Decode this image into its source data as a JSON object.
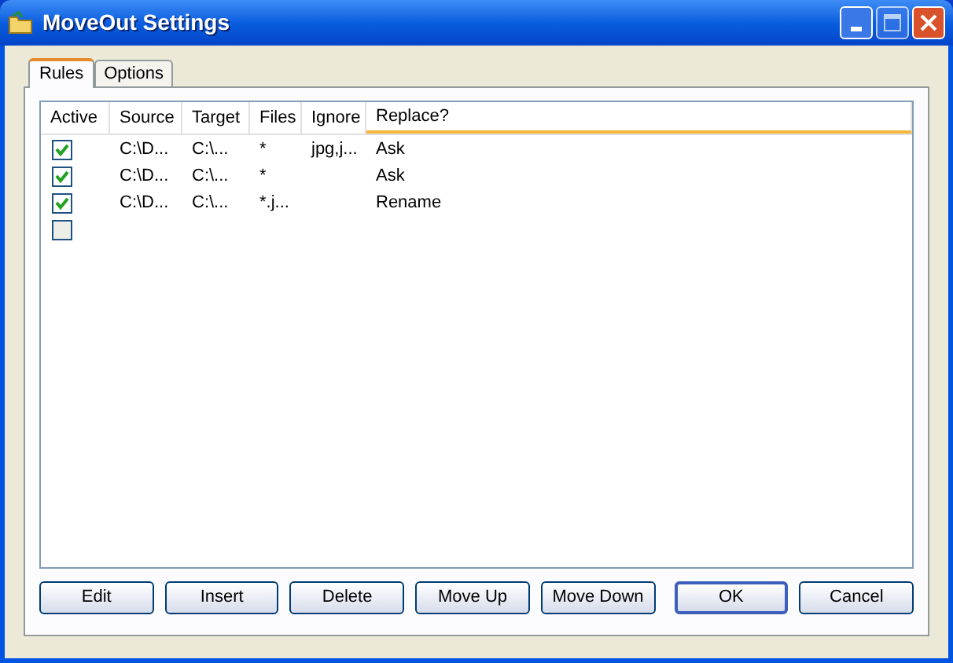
{
  "window": {
    "title": "MoveOut Settings"
  },
  "tabs": [
    {
      "label": "Rules",
      "selected": true
    },
    {
      "label": "Options",
      "selected": false
    }
  ],
  "table": {
    "columns": [
      "Active",
      "Source",
      "Target",
      "Files",
      "Ignore",
      "Replace?"
    ],
    "rows": [
      {
        "active": true,
        "source": "C:\\D...",
        "target": "C:\\...",
        "files": "*",
        "ignore": "jpg,j...",
        "replace": "Ask"
      },
      {
        "active": true,
        "source": "C:\\D...",
        "target": "C:\\...",
        "files": "*",
        "replace": "Ask"
      },
      {
        "active": true,
        "source": "C:\\D...",
        "target": "C:\\...",
        "files": "*.j...",
        "replace": "Rename"
      },
      {
        "active": false
      }
    ]
  },
  "buttons": [
    {
      "label": "Edit",
      "default": false
    },
    {
      "label": "Insert",
      "default": false
    },
    {
      "label": "Delete",
      "default": false
    },
    {
      "label": "Move Up",
      "default": false
    },
    {
      "label": "Move Down",
      "default": false
    },
    {
      "label": "OK",
      "default": true
    },
    {
      "label": "Cancel",
      "default": false
    }
  ]
}
